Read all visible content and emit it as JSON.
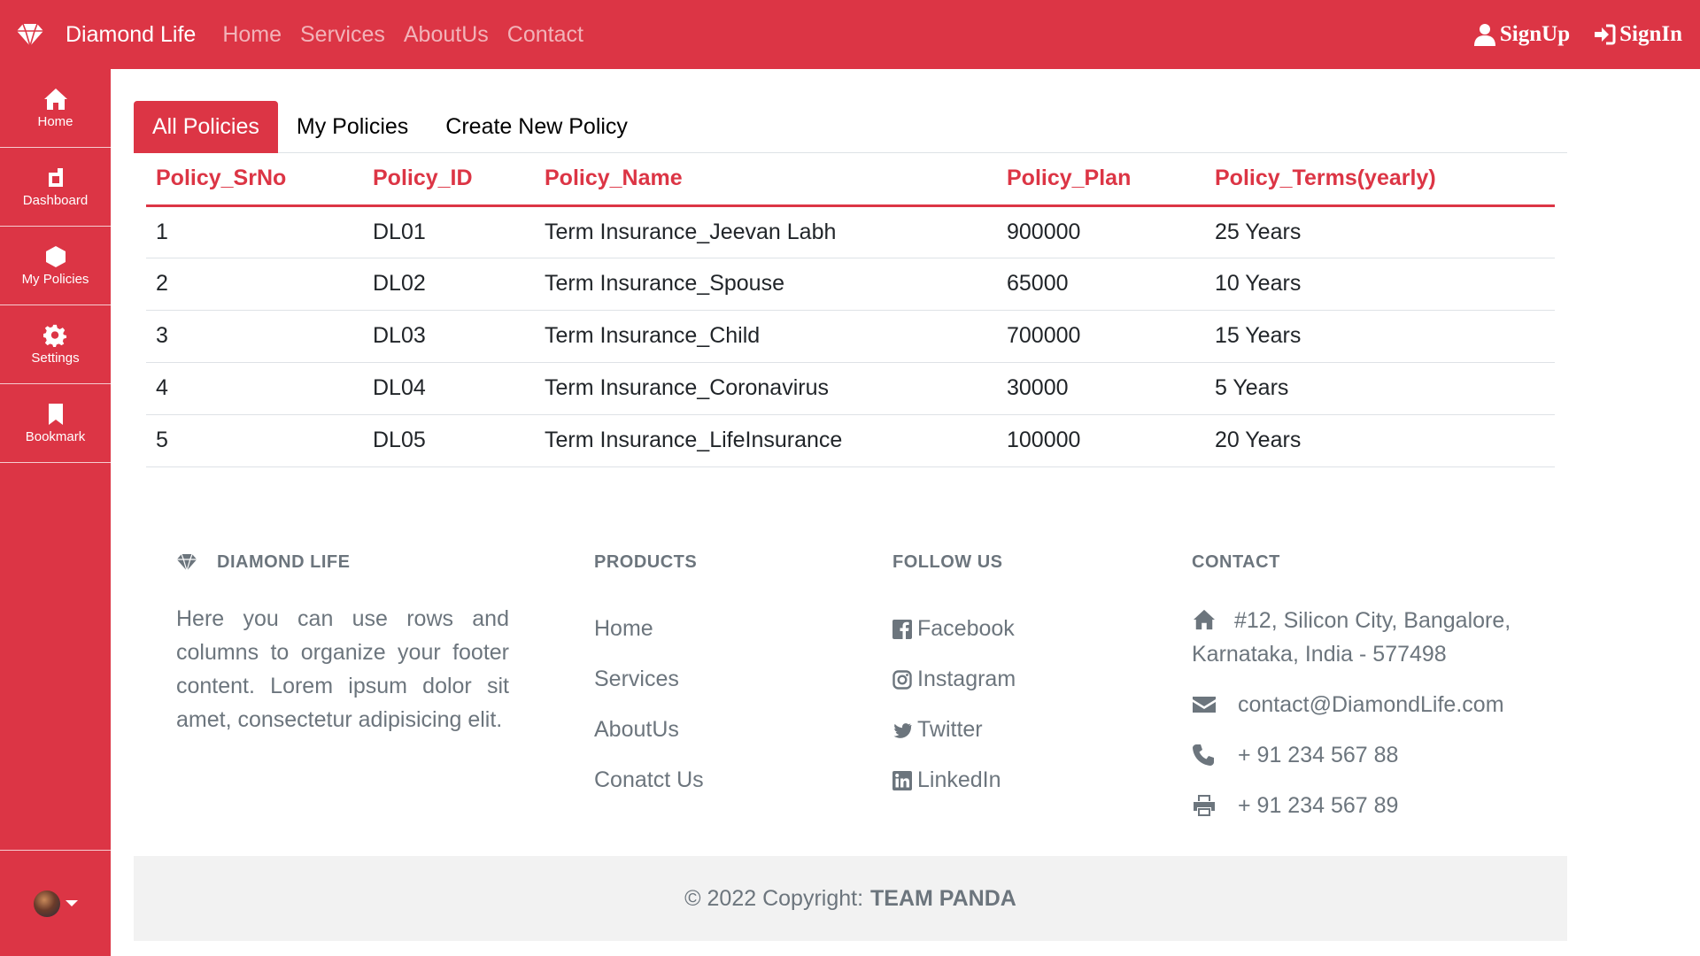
{
  "navbar": {
    "brand": "Diamond Life",
    "links": [
      "Home",
      "Services",
      "AboutUs",
      "Contact"
    ],
    "signup": "SignUp",
    "signin": "SignIn"
  },
  "sidebar": {
    "items": [
      {
        "label": "Home",
        "icon": "home-icon"
      },
      {
        "label": "Dashboard",
        "icon": "dashboard-icon"
      },
      {
        "label": "My Policies",
        "icon": "policies-icon"
      },
      {
        "label": "Settings",
        "icon": "gear-icon"
      },
      {
        "label": "Bookmark",
        "icon": "bookmark-icon"
      }
    ]
  },
  "tabs": [
    {
      "label": "All Policies",
      "active": true
    },
    {
      "label": "My Policies",
      "active": false
    },
    {
      "label": "Create New Policy",
      "active": false
    }
  ],
  "table": {
    "headers": [
      "Policy_SrNo",
      "Policy_ID",
      "Policy_Name",
      "Policy_Plan",
      "Policy_Terms(yearly)"
    ],
    "rows": [
      [
        "1",
        "DL01",
        "Term Insurance_Jeevan Labh",
        "900000",
        "25 Years"
      ],
      [
        "2",
        "DL02",
        "Term Insurance_Spouse",
        "65000",
        "10 Years"
      ],
      [
        "3",
        "DL03",
        "Term Insurance_Child",
        "700000",
        "15 Years"
      ],
      [
        "4",
        "DL04",
        "Term Insurance_Coronavirus",
        "30000",
        "5 Years"
      ],
      [
        "5",
        "DL05",
        "Term Insurance_LifeInsurance",
        "100000",
        "20 Years"
      ]
    ]
  },
  "footer": {
    "brand_heading": "DIAMOND LIFE",
    "about": "Here you can use rows and columns to organize your footer content. Lorem ipsum dolor sit amet, consectetur adipisicing elit.",
    "products_heading": "PRODUCTS",
    "products": [
      "Home",
      "Services",
      "AboutUs",
      "Conatct Us"
    ],
    "follow_heading": "FOLLOW US",
    "social": [
      "Facebook",
      "Instagram",
      "Twitter",
      "LinkedIn"
    ],
    "contact_heading": "CONTACT",
    "address": "#12, Silicon City, Bangalore, Karnataka, India - 577498",
    "email": "contact@DiamondLife.com",
    "phone": "+ 91 234 567 88",
    "fax": "+ 91 234 567 89"
  },
  "copyright": {
    "text": "© 2022 Copyright:",
    "team": "TEAM PANDA"
  },
  "colors": {
    "accent": "#dc3545",
    "muted_text": "#6c757d"
  }
}
